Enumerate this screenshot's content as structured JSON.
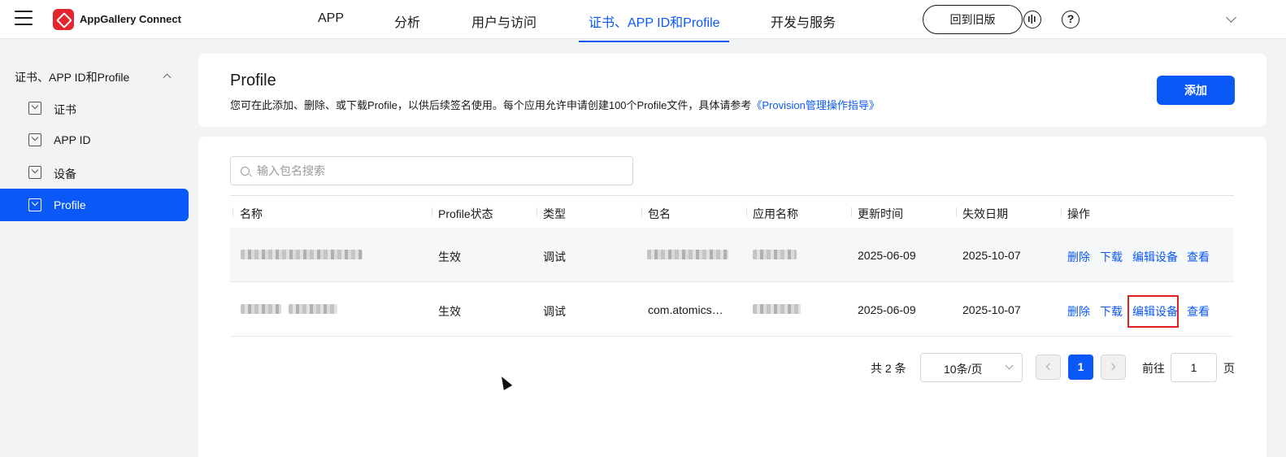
{
  "header": {
    "brand": "AppGallery Connect",
    "tabs": [
      "APP",
      "分析",
      "用户与访问",
      "证书、APP ID和Profile",
      "开发与服务"
    ],
    "active_tab": "证书、APP ID和Profile",
    "old_version_label": "回到旧版",
    "help_glyph": "?"
  },
  "sidebar": {
    "group_label": "证书、APP ID和Profile",
    "items": [
      {
        "label": "证书"
      },
      {
        "label": "APP ID"
      },
      {
        "label": "设备"
      },
      {
        "label": "Profile"
      }
    ],
    "active_item": "Profile"
  },
  "page": {
    "title": "Profile",
    "description": "您可在此添加、删除、或下载Profile，以供后续签名使用。每个应用允许申请创建100个Profile文件，具体请参考",
    "guide_link": "《Provision管理操作指导》",
    "add_label": "添加"
  },
  "search": {
    "placeholder": "输入包名搜索"
  },
  "table": {
    "columns": [
      "名称",
      "Profile状态",
      "类型",
      "包名",
      "应用名称",
      "更新时间",
      "失效日期",
      "操作"
    ],
    "rows": [
      {
        "status": "生效",
        "type": "调试",
        "package": "",
        "updated": "2025-06-09",
        "expires": "2025-10-07",
        "actions": [
          "删除",
          "下载",
          "编辑设备",
          "查看"
        ]
      },
      {
        "status": "生效",
        "type": "调试",
        "package": "com.atomics…",
        "updated": "2025-06-09",
        "expires": "2025-10-07",
        "actions": [
          "删除",
          "下载",
          "编辑设备",
          "查看"
        ]
      }
    ]
  },
  "pagination": {
    "total_text": "共 2 条",
    "page_size": "10条/页",
    "current_page": "1",
    "goto_label": "前往",
    "goto_value": "1",
    "page_suffix": "页"
  },
  "colors": {
    "accent": "#0a59f7",
    "highlight": "#e0201f",
    "brand_red": "#e5252d"
  }
}
